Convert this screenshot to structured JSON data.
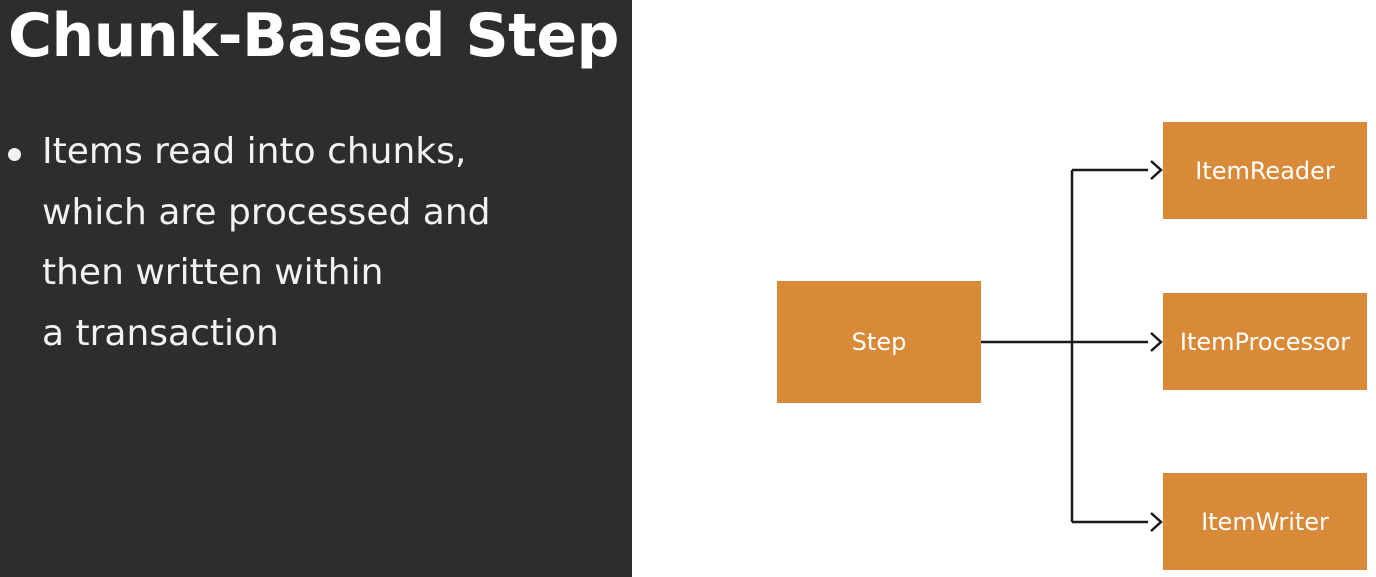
{
  "slide": {
    "title": "Chunk-Based Step",
    "bullets": [
      {
        "lines": [
          "Items read into chunks,",
          "which are processed and",
          "then written within",
          "a transaction"
        ]
      }
    ]
  },
  "diagram": {
    "source": {
      "label": "Step"
    },
    "targets": [
      {
        "label": "ItemReader"
      },
      {
        "label": "ItemProcessor"
      },
      {
        "label": "ItemWriter"
      }
    ]
  },
  "colors": {
    "panel_background": "#2d2d2f",
    "text_light": "#f2f2f2",
    "node_fill": "#d88a39",
    "node_text": "#ffffff",
    "connector": "#1a1a1a"
  }
}
